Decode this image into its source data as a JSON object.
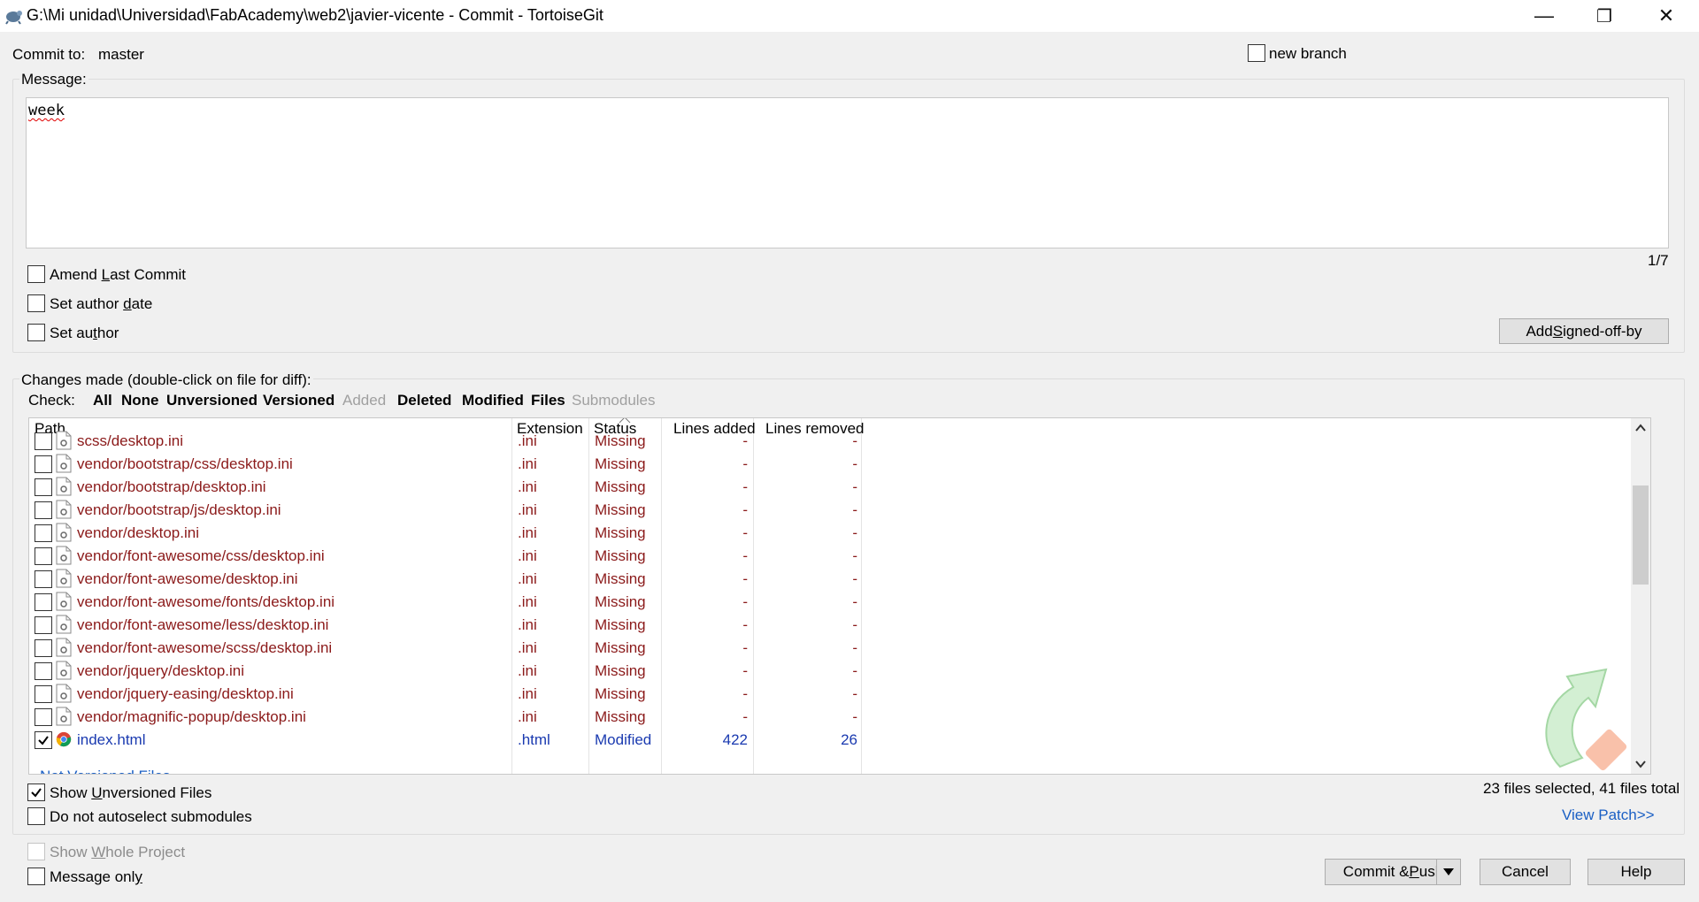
{
  "window": {
    "title": "G:\\Mi unidad\\Universidad\\FabAcademy\\web2\\javier-vicente - Commit - TortoiseGit",
    "minimize": "—",
    "maximize": "❐",
    "close": "✕"
  },
  "commit_to": {
    "label": "Commit to:",
    "branch": "master"
  },
  "new_branch": {
    "label": "new branch",
    "checked": false
  },
  "message": {
    "label": "Message:",
    "text": "week",
    "counter": "1/7"
  },
  "options": {
    "amend": {
      "pre": "Amend ",
      "key": "L",
      "post": "ast Commit",
      "checked": false
    },
    "author_date": {
      "pre": "Set author ",
      "key": "d",
      "post": "ate",
      "checked": false
    },
    "author": {
      "pre": "Set au",
      "key": "t",
      "post": "hor",
      "checked": false
    }
  },
  "signed_off": {
    "pre": "Add ",
    "key": "S",
    "post": "igned-off-by"
  },
  "changes": {
    "label": "Changes made (double-click on file for diff):",
    "check_label": "Check:",
    "filters": [
      {
        "label": "All",
        "enabled": true
      },
      {
        "label": "None",
        "enabled": true
      },
      {
        "label": "Unversioned",
        "enabled": true
      },
      {
        "label": "Versioned",
        "enabled": true
      },
      {
        "label": "Added",
        "enabled": false
      },
      {
        "label": "Deleted",
        "enabled": true
      },
      {
        "label": "Modified",
        "enabled": true
      },
      {
        "label": "Files",
        "enabled": true
      },
      {
        "label": "Submodules",
        "enabled": false
      }
    ],
    "columns": [
      "Path",
      "Extension",
      "Status",
      "Lines added",
      "Lines removed"
    ],
    "rows": [
      {
        "path": "scss/desktop.ini",
        "ext": ".ini",
        "status": "Missing",
        "added": "-",
        "removed": "-",
        "checked": false,
        "icon": "ini-file-icon"
      },
      {
        "path": "vendor/bootstrap/css/desktop.ini",
        "ext": ".ini",
        "status": "Missing",
        "added": "-",
        "removed": "-",
        "checked": false,
        "icon": "ini-file-icon"
      },
      {
        "path": "vendor/bootstrap/desktop.ini",
        "ext": ".ini",
        "status": "Missing",
        "added": "-",
        "removed": "-",
        "checked": false,
        "icon": "ini-file-icon"
      },
      {
        "path": "vendor/bootstrap/js/desktop.ini",
        "ext": ".ini",
        "status": "Missing",
        "added": "-",
        "removed": "-",
        "checked": false,
        "icon": "ini-file-icon"
      },
      {
        "path": "vendor/desktop.ini",
        "ext": ".ini",
        "status": "Missing",
        "added": "-",
        "removed": "-",
        "checked": false,
        "icon": "ini-file-icon"
      },
      {
        "path": "vendor/font-awesome/css/desktop.ini",
        "ext": ".ini",
        "status": "Missing",
        "added": "-",
        "removed": "-",
        "checked": false,
        "icon": "ini-file-icon"
      },
      {
        "path": "vendor/font-awesome/desktop.ini",
        "ext": ".ini",
        "status": "Missing",
        "added": "-",
        "removed": "-",
        "checked": false,
        "icon": "ini-file-icon"
      },
      {
        "path": "vendor/font-awesome/fonts/desktop.ini",
        "ext": ".ini",
        "status": "Missing",
        "added": "-",
        "removed": "-",
        "checked": false,
        "icon": "ini-file-icon"
      },
      {
        "path": "vendor/font-awesome/less/desktop.ini",
        "ext": ".ini",
        "status": "Missing",
        "added": "-",
        "removed": "-",
        "checked": false,
        "icon": "ini-file-icon"
      },
      {
        "path": "vendor/font-awesome/scss/desktop.ini",
        "ext": ".ini",
        "status": "Missing",
        "added": "-",
        "removed": "-",
        "checked": false,
        "icon": "ini-file-icon"
      },
      {
        "path": "vendor/jquery/desktop.ini",
        "ext": ".ini",
        "status": "Missing",
        "added": "-",
        "removed": "-",
        "checked": false,
        "icon": "ini-file-icon"
      },
      {
        "path": "vendor/jquery-easing/desktop.ini",
        "ext": ".ini",
        "status": "Missing",
        "added": "-",
        "removed": "-",
        "checked": false,
        "icon": "ini-file-icon"
      },
      {
        "path": "vendor/magnific-popup/desktop.ini",
        "ext": ".ini",
        "status": "Missing",
        "added": "-",
        "removed": "-",
        "checked": false,
        "icon": "ini-file-icon"
      },
      {
        "path": "index.html",
        "ext": ".html",
        "status": "Modified",
        "added": "422",
        "removed": "26",
        "checked": true,
        "icon": "chrome-icon"
      }
    ],
    "group_header": "Not Versioned Files"
  },
  "show_unversioned": {
    "pre": "Show ",
    "key": "U",
    "post": "nversioned Files",
    "checked": true
  },
  "no_autoselect": {
    "label": "Do not autoselect submodules",
    "checked": false
  },
  "summary": "23 files selected, 41 files total",
  "view_patch": "View Patch>>",
  "show_whole_project": {
    "pre": "Show ",
    "key": "W",
    "post": "hole Project",
    "checked": false,
    "enabled": false
  },
  "message_only": {
    "pre": "Message onl",
    "key": "y",
    "post": "",
    "checked": false
  },
  "buttons": {
    "commit_push": {
      "pre": "Commit & ",
      "key": "P",
      "post": "ush"
    },
    "cancel": "Cancel",
    "help": "Help"
  },
  "colors": {
    "missing": "#8b1a1a",
    "modified": "#1a3ab0",
    "link": "#1a5fc4"
  }
}
